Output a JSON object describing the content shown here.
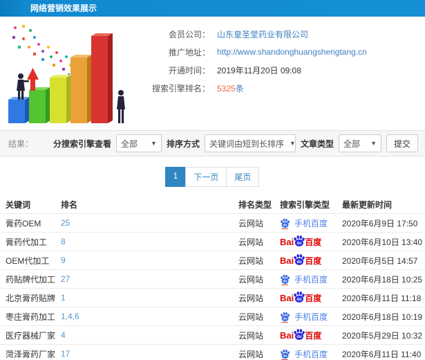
{
  "window": {
    "title": "网络营销效果展示"
  },
  "info": {
    "fields": [
      {
        "label": "会员公司：",
        "value": "山东皇圣堂药业有限公司"
      },
      {
        "label": "推广地址：",
        "value": "http://www.shandonghuangshengtang.cn"
      },
      {
        "label": "开通时间：",
        "value": "2019年11月20日 09:08"
      },
      {
        "label": "搜索引擎排名：",
        "value": "5325",
        "suffix": "条"
      }
    ]
  },
  "filters": {
    "result_label": "结果：",
    "engine_label": "分搜索引擎查看",
    "engine_value": "全部",
    "sort_label": "排序方式",
    "sort_value": "关键词由短到长排序",
    "article_label": "文章类型",
    "article_value": "全部",
    "submit_label": "提交"
  },
  "pagination": {
    "page": "1",
    "next": "下一页",
    "last": "尾页"
  },
  "table": {
    "headers": [
      "关键词",
      "排名",
      "排名类型",
      "搜索引擎类型",
      "最新更新时间"
    ],
    "rows": [
      {
        "keyword": "膏药OEM",
        "rank": "25",
        "rank_type": "云网站",
        "engine": "mobile",
        "updated": "2020年6月9日 17:50"
      },
      {
        "keyword": "膏药代加工",
        "rank": "8",
        "rank_type": "云网站",
        "engine": "baidu",
        "updated": "2020年6月10日 13:40"
      },
      {
        "keyword": "OEM代加工",
        "rank": "9",
        "rank_type": "云网站",
        "engine": "baidu",
        "updated": "2020年6月5日 14:57"
      },
      {
        "keyword": "药贴牌代加工",
        "rank": "27",
        "rank_type": "云网站",
        "engine": "mobile",
        "updated": "2020年6月18日 10:25"
      },
      {
        "keyword": "北京膏药贴牌",
        "rank": "1",
        "rank_type": "云网站",
        "engine": "baidu",
        "updated": "2020年6月11日 11:18"
      },
      {
        "keyword": "枣庄膏药加工",
        "rank": "1,4,6",
        "rank_type": "云网站",
        "engine": "mobile",
        "updated": "2020年6月18日 10:19"
      },
      {
        "keyword": "医疗器械厂家",
        "rank": "4",
        "rank_type": "云网站",
        "engine": "baidu",
        "updated": "2020年5月29日 10:32"
      },
      {
        "keyword": "菏泽膏药厂家",
        "rank": "17",
        "rank_type": "云网站",
        "engine": "mobile",
        "updated": "2020年6月11日 11:40"
      }
    ]
  },
  "brand": {
    "bai": "Bai",
    "du": "du",
    "baidu": "百度",
    "mobile": "手机百度"
  },
  "colors": {
    "header_blue": "#1289cf",
    "link_blue": "#3e7fc1",
    "rank_blue": "#5596d0",
    "accent_orange": "#f4693c",
    "active_page_blue": "#2f86c1",
    "baidu_red": "#e10601",
    "baidu_blue": "#2529dc",
    "mobile_blue": "#4b7fe6"
  }
}
